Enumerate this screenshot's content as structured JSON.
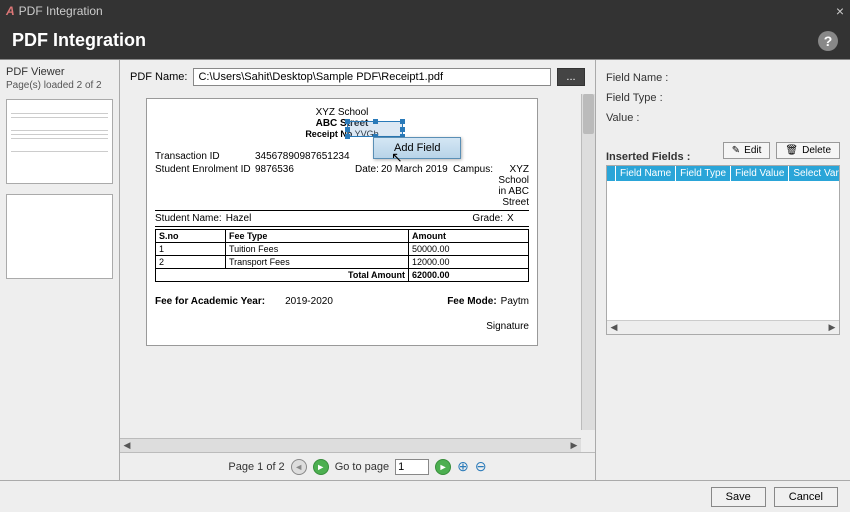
{
  "window": {
    "title": "PDF Integration",
    "close_glyph": "×"
  },
  "header": {
    "title": "PDF Integration",
    "help_glyph": "?"
  },
  "sidebar": {
    "title": "PDF Viewer",
    "loaded": "Page(s) loaded 2 of 2"
  },
  "pdfname": {
    "label": "PDF Name:",
    "value": "C:\\Users\\Sahit\\Desktop\\Sample PDF\\Receipt1.pdf",
    "browse": "..."
  },
  "contextmenu": {
    "add_field": "Add Field"
  },
  "receipt": {
    "school": "XYZ School",
    "street": "ABC Street",
    "receipt_label": "Receipt No",
    "receipt_no_partial": "YVGb",
    "trans_label": "Transaction ID",
    "trans_id": "34567890987651234",
    "enrol_label": "Student Enrolment ID",
    "enrol_id": "9876536",
    "date_label": "Date:",
    "date": "20 March 2019",
    "campus_label": "Campus:",
    "campus": "XYZ School in ABC Street",
    "student_label": "Student Name:",
    "student": "Hazel",
    "grade_label": "Grade:",
    "grade": "X",
    "col_sno": "S.no",
    "col_feetype": "Fee Type",
    "col_amount": "Amount",
    "rows": [
      {
        "sno": "1",
        "type": "Tuition Fees",
        "amount": "50000.00"
      },
      {
        "sno": "2",
        "type": "Transport Fees",
        "amount": "12000.00"
      }
    ],
    "total_label": "Total Amount",
    "total": "62000.00",
    "year_label": "Fee for Academic Year:",
    "year": "2019-2020",
    "mode_label": "Fee Mode:",
    "mode": "Paytm",
    "signature": "Signature"
  },
  "pager": {
    "page_of": "Page 1 of 2",
    "goto_label": "Go to page",
    "goto_value": "1"
  },
  "right": {
    "fieldname_label": "Field Name :",
    "fieldtype_label": "Field Type :",
    "value_label": "Value :",
    "inserted_label": "Inserted Fields :",
    "edit": "Edit",
    "delete": "Delete",
    "cols": {
      "name": "Field Name",
      "type": "Field Type",
      "value": "Field Value",
      "var": "Select Varia"
    }
  },
  "footer": {
    "save": "Save",
    "cancel": "Cancel"
  },
  "icons": {
    "prev": "◄",
    "next": "►",
    "zoom_in": "⊕",
    "zoom_out": "⊖",
    "pencil": "✎",
    "trash": "🗑",
    "left": "◀",
    "right": "▶"
  }
}
